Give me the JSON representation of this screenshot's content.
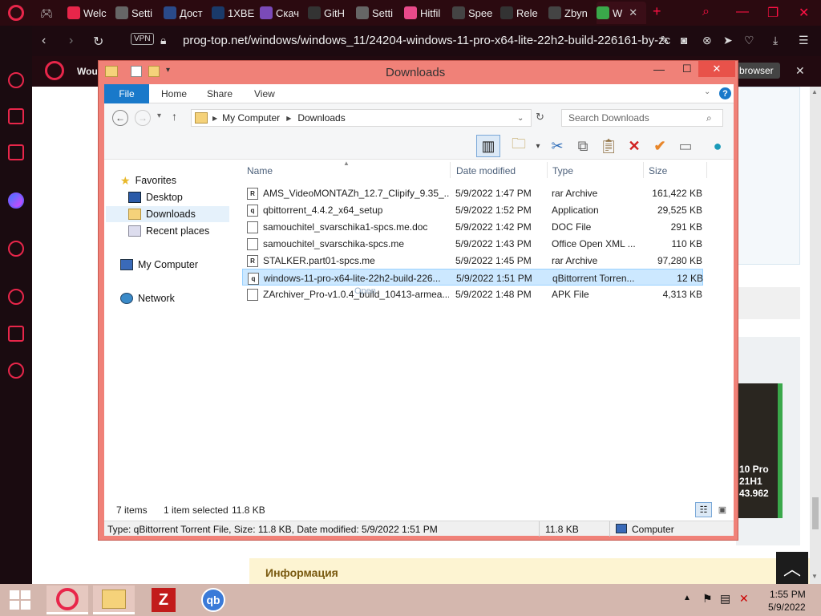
{
  "browser": {
    "tabs": [
      {
        "label": "Welc",
        "icon": "opera-icon",
        "color": "#e8264a"
      },
      {
        "label": "Setti",
        "icon": "gear-icon",
        "color": "#666"
      },
      {
        "label": "Дост",
        "icon": "site-icon",
        "color": "#2a4a8a"
      },
      {
        "label": "1XBE",
        "icon": "site-icon",
        "color": "#1a3a6a"
      },
      {
        "label": "Скач",
        "icon": "s-icon",
        "color": "#7a4ab8"
      },
      {
        "label": "GitH",
        "icon": "github-icon",
        "color": "#333"
      },
      {
        "label": "Setti",
        "icon": "gear-icon",
        "color": "#666"
      },
      {
        "label": "Hitfil",
        "icon": "hitfile-icon",
        "color": "#e84a8a"
      },
      {
        "label": "Spee",
        "icon": "grid-icon",
        "color": "#444"
      },
      {
        "label": "Rele",
        "icon": "github-icon",
        "color": "#333"
      },
      {
        "label": "Zbyn",
        "icon": "globe-icon",
        "color": "#444"
      },
      {
        "label": "W",
        "icon": "w-icon",
        "color": "#3aa84a"
      }
    ],
    "url": "prog-top.net/windows/windows_11/24204-windows-11-pro-x64-lite-22h2-build-226161-by-zc",
    "vpn_label": "VPN",
    "notification_text": "Wou",
    "notification_button": "browser"
  },
  "explorer": {
    "title": "Downloads",
    "ribbon_tabs": [
      "File",
      "Home",
      "Share",
      "View"
    ],
    "breadcrumb": [
      "My Computer",
      "Downloads"
    ],
    "search_placeholder": "Search Downloads",
    "nav": {
      "favorites": "Favorites",
      "desktop": "Desktop",
      "downloads": "Downloads",
      "recent": "Recent places",
      "computer": "My Computer",
      "network": "Network"
    },
    "columns": [
      "Name",
      "Date modified",
      "Type",
      "Size"
    ],
    "files": [
      {
        "name": "AMS_VideoMONTAZh_12.7_Clipify_9.35_...",
        "date": "5/9/2022 1:47 PM",
        "type": "rar Archive",
        "size": "161,422 KB",
        "icon": "R"
      },
      {
        "name": "qbittorrent_4.4.2_x64_setup",
        "date": "5/9/2022 1:52 PM",
        "type": "Application",
        "size": "29,525 KB",
        "icon": "q"
      },
      {
        "name": "samouchitel_svarschika1-spcs.me.doc",
        "date": "5/9/2022 1:42 PM",
        "type": "DOC File",
        "size": "291 KB",
        "icon": ""
      },
      {
        "name": "samouchitel_svarschika-spcs.me",
        "date": "5/9/2022 1:43 PM",
        "type": "Office Open XML ...",
        "size": "110 KB",
        "icon": ""
      },
      {
        "name": "STALKER.part01-spcs.me",
        "date": "5/9/2022 1:45 PM",
        "type": "rar Archive",
        "size": "97,280 KB",
        "icon": "R"
      },
      {
        "name": "windows-11-pro-x64-lite-22h2-build-226...",
        "date": "5/9/2022 1:51 PM",
        "type": "qBittorrent Torren...",
        "size": "12 KB",
        "icon": "q"
      },
      {
        "name": "ZArchiver_Pro-v1.0.4_build_10413-armea...",
        "date": "5/9/2022 1:48 PM",
        "type": "APK File",
        "size": "4,313 KB",
        "icon": ""
      }
    ],
    "selected_index": 5,
    "ghost_text": "Open",
    "status_items": "7 items",
    "status_selected": "1 item selected",
    "status_size": "11.8 KB",
    "detail_text": "Type: qBittorrent Torrent File, Size: 11.8 KB, Date modified: 5/9/2022 1:51 PM",
    "detail_size": "11.8 KB",
    "detail_location": "Computer"
  },
  "page": {
    "info_label": "Информация",
    "cover_lines": [
      "10 Pro",
      "21H1",
      "43.962"
    ]
  },
  "taskbar": {
    "time": "1:55 PM",
    "date": "5/9/2022"
  },
  "colors": {
    "explorer_frame": "#f08178",
    "ribbon_file": "#1979ca",
    "selection": "#cce8ff",
    "opera_red": "#e8264a"
  }
}
